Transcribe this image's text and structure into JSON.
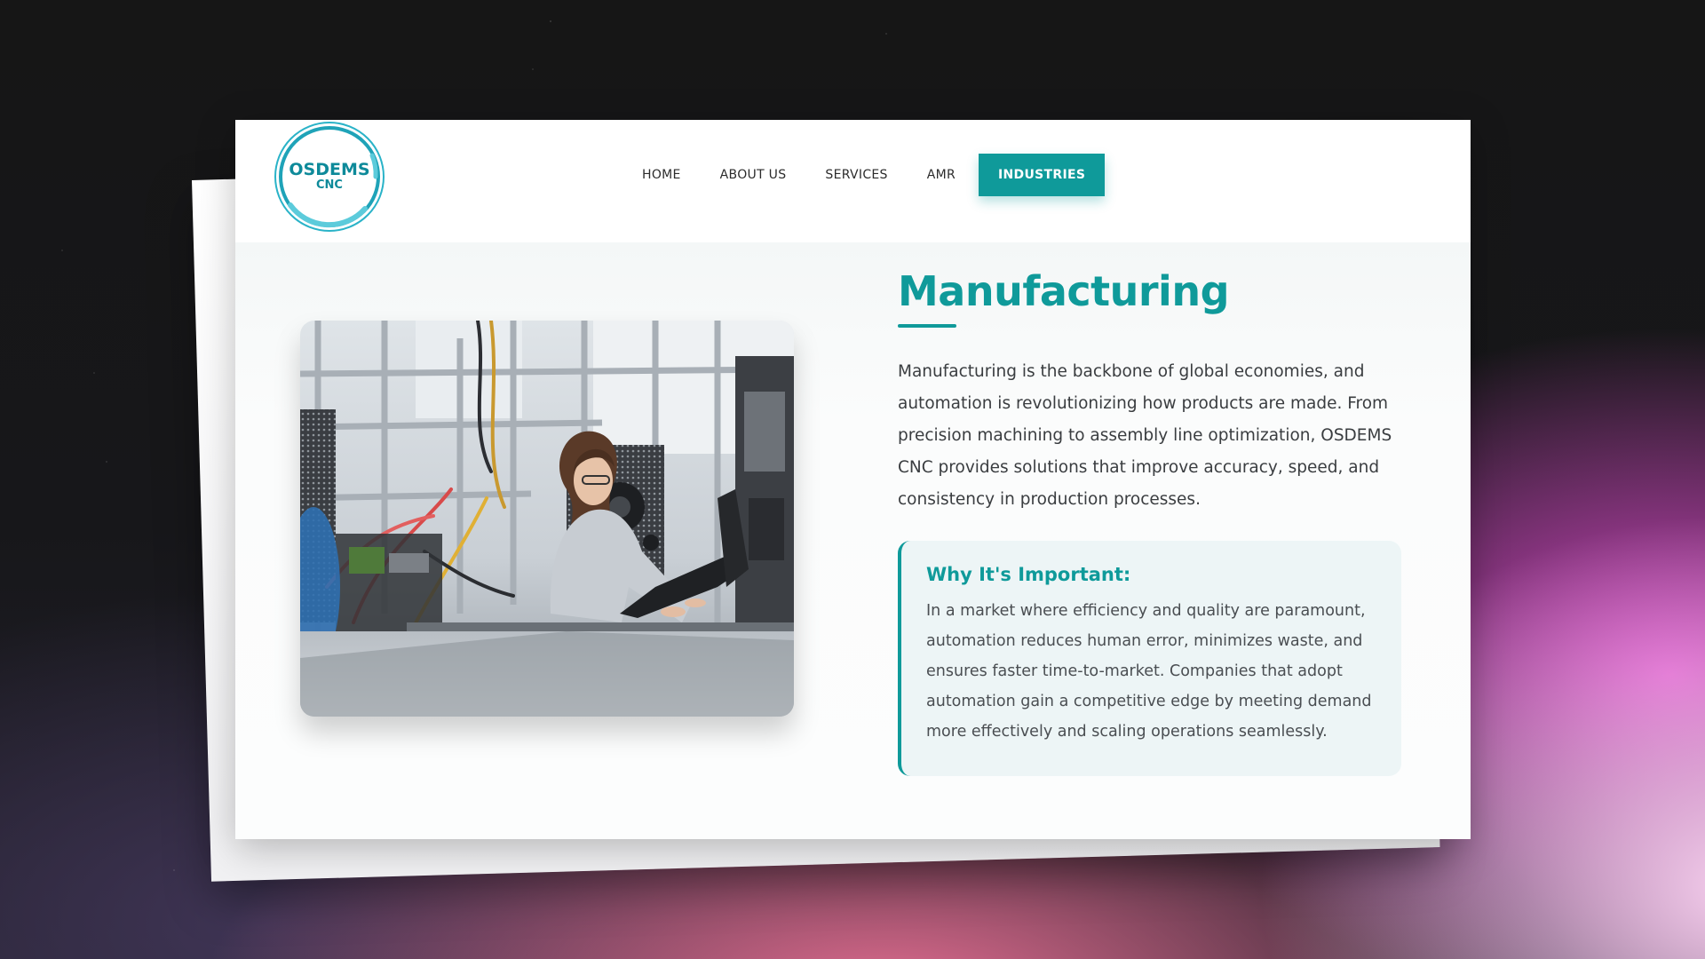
{
  "brand": {
    "logo_line1": "OSDEMS",
    "logo_line2": "CNC",
    "accent_color": "#0f9a9a",
    "logo_ring_color": "#2ab3c8"
  },
  "nav": {
    "items": [
      {
        "label": "HOME",
        "active": false
      },
      {
        "label": "ABOUT US",
        "active": false
      },
      {
        "label": "SERVICES",
        "active": false
      },
      {
        "label": "AMR",
        "active": false
      },
      {
        "label": "INDUSTRIES",
        "active": true
      }
    ]
  },
  "main": {
    "title": "Manufacturing",
    "intro": "Manufacturing is the backbone of global economies, and automation is revolutionizing how products are made. From precision machining to assembly line optimization, OSDEMS CNC provides solutions that improve accuracy, speed, and consistency in production processes.",
    "callout": {
      "title": "Why It's Important:",
      "body": "In a market where efficiency and quality are paramount, automation reduces human error, minimizes waste, and ensures faster time-to-market. Companies that adopt automation gain a competitive edge by meeting demand more effectively and scaling operations seamlessly."
    }
  }
}
